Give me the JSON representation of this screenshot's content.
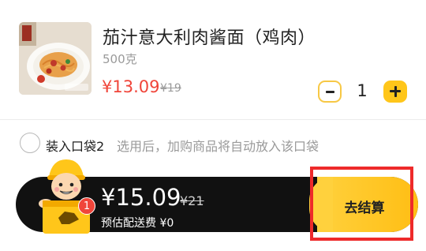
{
  "product": {
    "name": "茄汁意大利肉酱面（鸡肉）",
    "weight": "500克",
    "price": "¥13.09",
    "original_price": "¥19",
    "quantity": "1",
    "image_icon": "spaghetti-plate"
  },
  "bag_option": {
    "label": "装入口袋2",
    "hint": "选用后，加购商品将自动放入该口袋",
    "checked": false
  },
  "checkout": {
    "cart_count": "1",
    "total_price": "¥15.09",
    "original_total": "¥21",
    "delivery_fee": "预估配送费 ¥0",
    "button_label": "去结算",
    "mascot_icon": "delivery-rider-mascot"
  },
  "colors": {
    "accent_yellow": "#ffc61a",
    "price_red": "#f0453a",
    "bar_black": "#111111",
    "highlight_red": "#ee2a2a"
  }
}
